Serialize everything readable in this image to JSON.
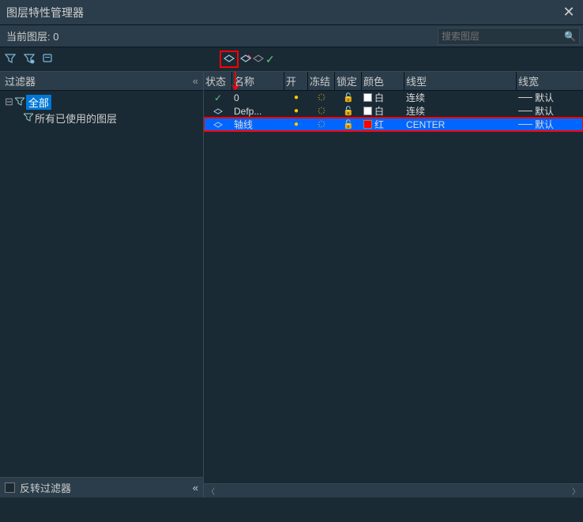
{
  "title": "图层特性管理器",
  "current_layer_label": "当前图层:  0",
  "search_placeholder": "搜索图层",
  "filter_header": "过滤器",
  "tree": {
    "root": "全部",
    "child": "所有已使用的图层"
  },
  "invert_filter_label": "反转过滤器",
  "columns": {
    "status": "状态",
    "name": "名称",
    "on": "开",
    "freeze": "冻结",
    "lock": "锁定",
    "color": "颜色",
    "linetype": "线型",
    "lineweight": "线宽"
  },
  "rows": [
    {
      "status": "current",
      "name": "0",
      "color_name": "白",
      "color": "white",
      "linetype": "连续",
      "lineweight": "默认"
    },
    {
      "status": "layer",
      "name": "Defp...",
      "color_name": "白",
      "color": "white",
      "linetype": "连续",
      "lineweight": "默认"
    },
    {
      "status": "layer",
      "name": "轴线",
      "color_name": "红",
      "color": "red",
      "linetype": "CENTER",
      "lineweight": "默认",
      "selected": true
    }
  ]
}
